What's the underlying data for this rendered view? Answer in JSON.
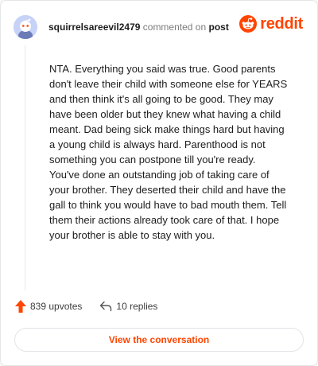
{
  "comment": {
    "author": "squirrelsareevil2479",
    "verb": "commented on",
    "target": "post",
    "body": "NTA. Everything you said was true. Good parents don't leave their child with someone else for YEARS and then think it's all going to be good. They may have been older but they knew what having a child meant. Dad being sick make things hard but having a young child is always hard. Parenthood is not something you can postpone till you're ready. You've done an outstanding job of taking care of your brother. They deserted their child and have the gall to think you would have to bad mouth them. Tell them their actions already took care of that. I hope your brother is able to stay with you."
  },
  "brand": {
    "wordmark": "reddit",
    "color": "#ff4500",
    "icon": "reddit-logo-icon"
  },
  "actions": {
    "upvotes": "839 upvotes",
    "replies": "10 replies",
    "upvote_icon": "upvote-arrow-icon",
    "reply_icon": "reply-arrow-icon"
  },
  "cta": {
    "label": "View the conversation"
  },
  "colors": {
    "accent": "#ff4500",
    "avatar_bg": "#c7d2f7"
  }
}
